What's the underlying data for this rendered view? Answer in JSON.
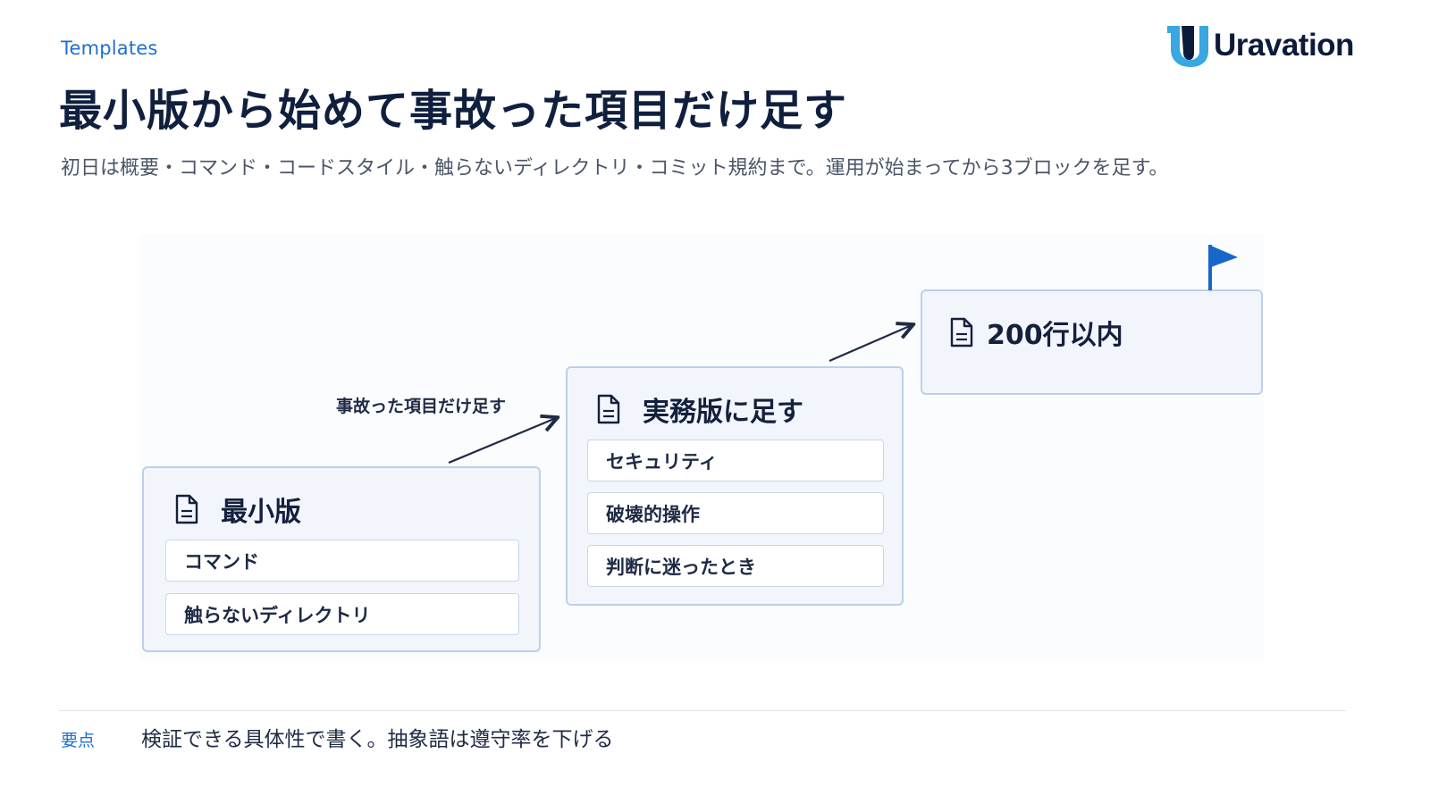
{
  "header": {
    "section_label": "Templates",
    "brand": "Uravation",
    "title": "最小版から始めて事故った項目だけ足す",
    "subtitle": "初日は概要・コマンド・コードスタイル・触らないディレクトリ・コミット規約まで。運用が始まってから3ブロックを足す。"
  },
  "diagram": {
    "arrow_label": "事故った項目だけ足す",
    "steps": [
      {
        "title": "最小版",
        "items": [
          "コマンド",
          "触らないディレクトリ"
        ]
      },
      {
        "title": "実務版に足す",
        "items": [
          "セキュリティ",
          "破壊的操作",
          "判断に迷ったとき"
        ]
      },
      {
        "title": "200行以内",
        "items": []
      }
    ]
  },
  "footer": {
    "key_label": "要点",
    "key_text": "検証できる具体性で書く。抽象語は遵守率を下げる"
  },
  "colors": {
    "accent": "#1f6fd1",
    "navy": "#0f1f3d",
    "box_fill": "#f2f6fc",
    "box_border": "#bcd0ea"
  },
  "icons": [
    "document-icon",
    "flag-icon",
    "arrow-icon",
    "brand-logo-mark"
  ]
}
